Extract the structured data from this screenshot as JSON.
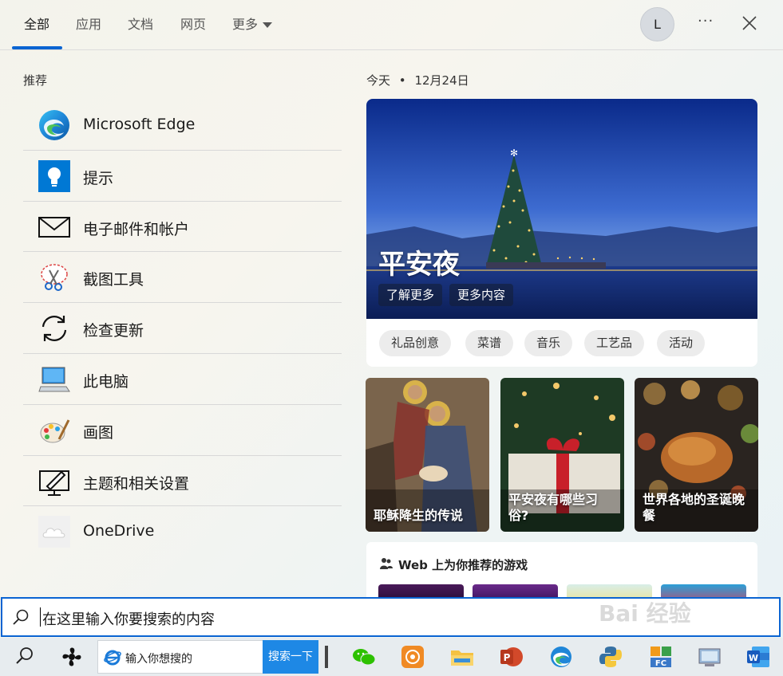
{
  "tabs": [
    {
      "label": "全部",
      "active": true
    },
    {
      "label": "应用"
    },
    {
      "label": "文档"
    },
    {
      "label": "网页"
    },
    {
      "label": "更多"
    }
  ],
  "account": {
    "initial": "L"
  },
  "recommend": {
    "title": "推荐",
    "items": [
      {
        "label": "Microsoft Edge",
        "icon": "edge-icon"
      },
      {
        "label": "提示",
        "icon": "tips-icon"
      },
      {
        "label": "电子邮件和帐户",
        "icon": "mail-icon"
      },
      {
        "label": "截图工具",
        "icon": "snipping-tool-icon"
      },
      {
        "label": "检查更新",
        "icon": "update-icon"
      },
      {
        "label": "此电脑",
        "icon": "computer-icon"
      },
      {
        "label": "画图",
        "icon": "paint-icon"
      },
      {
        "label": "主题和相关设置",
        "icon": "theme-settings-icon"
      },
      {
        "label": "OneDrive",
        "icon": "onedrive-icon"
      }
    ]
  },
  "today": {
    "label": "今天",
    "separator": "•",
    "date": "12月24日"
  },
  "hero": {
    "title": "平安夜",
    "btn_learn": "了解更多",
    "btn_more": "更多内容",
    "chips": [
      "礼品创意",
      "菜谱",
      "音乐",
      "工艺品",
      "活动"
    ]
  },
  "cards": [
    {
      "title": "耶稣降生的传说"
    },
    {
      "title": "平安夜有哪些习俗?"
    },
    {
      "title": "世界各地的圣诞晚餐"
    }
  ],
  "games": {
    "title": "Web 上为你推荐的游戏"
  },
  "search": {
    "placeholder": "在这里输入你要搜索的内容"
  },
  "taskbar": {
    "search_placeholder": "输入你想搜的",
    "search_button": "搜索一下"
  },
  "colors": {
    "accent": "#0a64d2",
    "taskbar_button": "#1e88e5"
  }
}
